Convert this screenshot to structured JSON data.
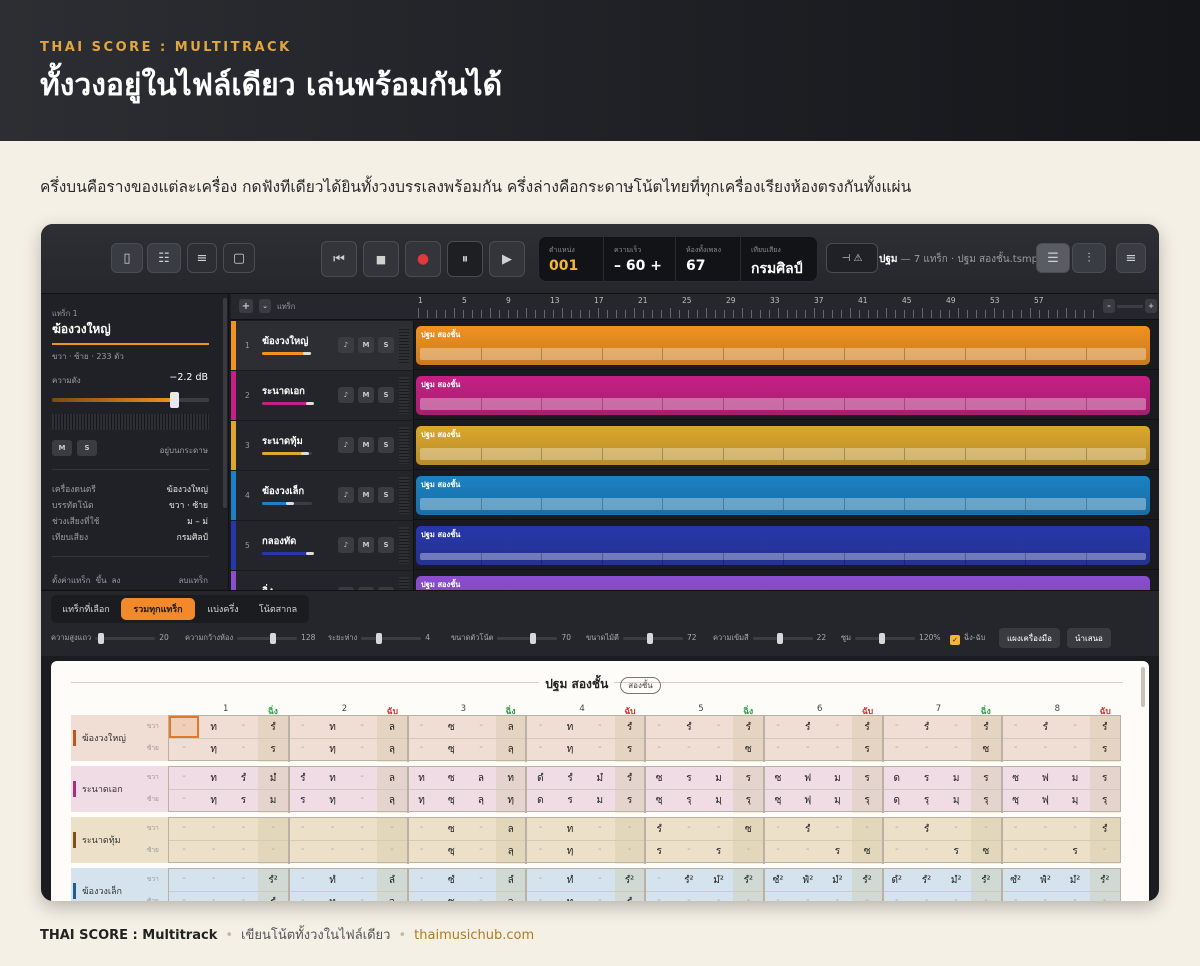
{
  "hero": {
    "eyebrow": "THAI SCORE : MULTITRACK",
    "title": "ทั้งวงอยู่ในไฟล์เดียว เล่นพร้อมกันได้"
  },
  "lead": "ครึ่งบนคือรางของแต่ละเครื่อง กดฟังทีเดียวได้ยินทั้งวงบรรเลงพร้อมกัน ครึ่งล่างคือกระดาษโน้ตไทยที่ทุกเครื่องเรียงห้องตรงกันทั้งแผ่น",
  "toolbar": {
    "lcd": [
      {
        "label": "ตำแหน่ง",
        "value": "001",
        "accent": "#f5b53a"
      },
      {
        "label": "ความเร็ว",
        "value": "– 60 +",
        "accent": "#ffffff"
      },
      {
        "label": "ห้องทั้งเพลง",
        "value": "67",
        "accent": "#ffffff"
      },
      {
        "label": "เทียบเสียง",
        "value": "กรมศิลป์",
        "accent": "#ffffff"
      }
    ],
    "project_name": "ปฐม",
    "project_meta": "— 7 แทร็ก · ปฐม สองชั้น.tsmproj"
  },
  "inspector": {
    "track_label": "แทร็ก 1",
    "track_name": "ฆ้องวงใหญ่",
    "track_sub": "ขวา · ซ้าย · 233 ตัว",
    "volume_label": "ความดัง",
    "volume_value": "−2.2 dB",
    "volume_level": 0.78,
    "m_label": "M",
    "s_label": "S",
    "on_paper": "อยู่บนกระดาษ",
    "props": [
      {
        "k": "เครื่องดนตรี",
        "v": "ฆ้องวงใหญ่"
      },
      {
        "k": "บรรทัดโน้ต",
        "v": "ขวา · ซ้าย"
      },
      {
        "k": "ช่วงเสียงที่ใช้",
        "v": "ม – ม่"
      },
      {
        "k": "เทียบเสียง",
        "v": "กรมศิลป์"
      }
    ],
    "settings": "ตั้งค่าแทร็ก",
    "up": "ขึ้น",
    "down": "ลง",
    "delete": "ลบแทร็ก"
  },
  "tracks_header": {
    "add": "+",
    "label": "แทร็ก"
  },
  "ruler": [
    "1",
    "5",
    "9",
    "13",
    "17",
    "21",
    "25",
    "29",
    "33",
    "37",
    "41",
    "45",
    "49",
    "53",
    "57"
  ],
  "tracks": [
    {
      "num": "1",
      "name": "ฆ้องวงใหญ่",
      "color": "#f2921f",
      "level": 0.9,
      "clip": "ปฐม สองชั้น",
      "lane_level": 1.0
    },
    {
      "num": "2",
      "name": "ระนาดเอก",
      "color": "#c71f85",
      "level": 0.95,
      "clip": "ปฐม สองชั้น",
      "lane_level": 1.0
    },
    {
      "num": "3",
      "name": "ระนาดทุ้ม",
      "color": "#dca72c",
      "level": 0.85,
      "clip": "ปฐม สองชั้น",
      "lane_level": 1.0
    },
    {
      "num": "4",
      "name": "ฆ้องวงเล็ก",
      "color": "#1a82c4",
      "level": 0.55,
      "clip": "ปฐม สองชั้น",
      "lane_level": 1.0
    },
    {
      "num": "5",
      "name": "กลองทัด",
      "color": "#2737ab",
      "level": 0.95,
      "clip": "ปฐม สองชั้น",
      "lane_level": 0.6
    },
    {
      "num": "6",
      "name": "ฉิ่ง",
      "color": "#8b4ed0",
      "level": 0.7,
      "clip": "ปฐม สองชั้น",
      "lane_level": 1.0
    }
  ],
  "m_btn": "M",
  "s_btn": "S",
  "rec_btn": "♪",
  "tabs": [
    "แทร็กที่เลือก",
    "รวมทุกแทร็ก",
    "แบ่งครึ่ง",
    "โน้ตสากล"
  ],
  "controls": [
    {
      "label": "ความสูงแถว",
      "value": "20",
      "level": 0.1
    },
    {
      "label": "ความกว้างห้อง",
      "value": "128",
      "level": 0.6
    },
    {
      "label": "ระยะห่าง",
      "value": "4",
      "level": 0.3
    },
    {
      "label": "ขนาดตัวโน้ต",
      "value": "70",
      "level": 0.6
    },
    {
      "label": "ขนาดไม้ตี",
      "value": "72",
      "level": 0.45
    },
    {
      "label": "ความเข้มสี",
      "value": "22",
      "level": 0.45
    },
    {
      "label": "ซูม",
      "value": "120%",
      "level": 0.45
    }
  ],
  "ching_check": "ฉิ่ง-ฉับ",
  "btn_instruments": "แผงเครื่องมือ",
  "btn_present": "นำเสนอ",
  "score": {
    "title": "ปฐม สองชั้น",
    "badge": "สองชั้น",
    "measures": [
      "1",
      "2",
      "3",
      "4",
      "5",
      "6",
      "7",
      "8"
    ],
    "measure_marks": [
      "ฉิ่ง",
      "ฉับ",
      "ฉิ่ง",
      "ฉับ",
      "ฉิ่ง",
      "ฉับ",
      "ฉิ่ง",
      "ฉับ"
    ],
    "hand_right": "ขวา",
    "hand_left": "ซ้าย",
    "instruments": [
      {
        "name": "ฆ้องวงใหญ่",
        "color": "#c1581a",
        "bg": "#f0ddd3",
        "right": [
          "-",
          "ท",
          "-",
          "รํ",
          "-",
          "ท",
          "-",
          "ล",
          "-",
          "ซ",
          "-",
          "ล",
          "-",
          "ท",
          "-",
          "รํ",
          "-",
          "รํ",
          "-",
          "รํ",
          "-",
          "รํ",
          "-",
          "รํ",
          "-",
          "รํ",
          "-",
          "รํ",
          "-",
          "รํ",
          "-",
          "รํ"
        ],
        "left": [
          "-",
          "ทฺ",
          "-",
          "ร",
          "-",
          "ทฺ",
          "-",
          "ลฺ",
          "-",
          "ซฺ",
          "-",
          "ลฺ",
          "-",
          "ทฺ",
          "-",
          "ร",
          "-",
          "-",
          "-",
          "ซ",
          "-",
          "-",
          "-",
          "ร",
          "-",
          "-",
          "-",
          "ซ",
          "-",
          "-",
          "-",
          "ร"
        ]
      },
      {
        "name": "ระนาดเอก",
        "color": "#b02b7f",
        "bg": "#f0dce4",
        "right": [
          "-",
          "ท",
          "รํ",
          "มํ",
          "รํ",
          "ท",
          "-",
          "ล",
          "ท",
          "ซ",
          "ล",
          "ท",
          "ดํ",
          "รํ",
          "มํ",
          "รํ",
          "ซ",
          "ร",
          "ม",
          "ร",
          "ซ",
          "ฟ",
          "ม",
          "ร",
          "ด",
          "ร",
          "ม",
          "ร",
          "ซ",
          "ฟ",
          "ม",
          "ร"
        ],
        "left": [
          "-",
          "ทฺ",
          "ร",
          "ม",
          "ร",
          "ทฺ",
          "-",
          "ลฺ",
          "ทฺ",
          "ซฺ",
          "ลฺ",
          "ทฺ",
          "ด",
          "ร",
          "ม",
          "ร",
          "ซฺ",
          "รฺ",
          "มฺ",
          "รฺ",
          "ซฺ",
          "ฟฺ",
          "มฺ",
          "รฺ",
          "ดฺ",
          "รฺ",
          "มฺ",
          "รฺ",
          "ซฺ",
          "ฟฺ",
          "มฺ",
          "รฺ"
        ]
      },
      {
        "name": "ระนาดทุ้ม",
        "color": "#7a5516",
        "bg": "#ece1c8",
        "right": [
          "-",
          "-",
          "-",
          "-",
          "-",
          "-",
          "-",
          "-",
          "-",
          "ซ",
          "-",
          "ล",
          "-",
          "ท",
          "-",
          "-",
          "รํ",
          "-",
          "-",
          "ซ",
          "-",
          "รํ",
          "-",
          "-",
          "-",
          "รํ",
          "-",
          "-",
          "-",
          "-",
          "-",
          "รํ"
        ],
        "left": [
          "-",
          "-",
          "-",
          "-",
          "-",
          "-",
          "-",
          "-",
          "-",
          "ซฺ",
          "-",
          "ลฺ",
          "-",
          "ทฺ",
          "-",
          "-",
          "ร",
          "-",
          "ร",
          "-",
          "-",
          "-",
          "ร",
          "ซ",
          "-",
          "-",
          "ร",
          "ซ",
          "-",
          "-",
          "ร",
          "-"
        ]
      },
      {
        "name": "ฆ้องวงเล็ก",
        "color": "#1b5f93",
        "bg": "#d5e3ee",
        "right": [
          "-",
          "-",
          "-",
          "รํ²",
          "-",
          "ทํ",
          "-",
          "ลํ",
          "-",
          "ซํ",
          "-",
          "ลํ",
          "-",
          "ทํ",
          "-",
          "รํ²",
          "-",
          "รํ²",
          "มํ²",
          "รํ²",
          "ซํ²",
          "ฟํ²",
          "มํ²",
          "รํ²",
          "ดํ²",
          "รํ²",
          "มํ²",
          "รํ²",
          "ซํ²",
          "ฟํ²",
          "มํ²",
          "รํ²"
        ],
        "left": [
          "-",
          "-",
          "-",
          "รํ",
          "-",
          "ท",
          "-",
          "ล",
          "-",
          "ซ",
          "-",
          "ล",
          "-",
          "ท",
          "-",
          "รํ",
          "-",
          "-",
          "-",
          "-",
          "-",
          "-",
          "-",
          "-",
          "-",
          "-",
          "-",
          "-",
          "-",
          "-",
          "-",
          "-"
        ]
      }
    ]
  },
  "footer": {
    "brand": "THAI SCORE : Multitrack",
    "tagline": "เขียนโน้ตทั้งวงในไฟล์เดียว",
    "site": "thaimusichub.com"
  }
}
